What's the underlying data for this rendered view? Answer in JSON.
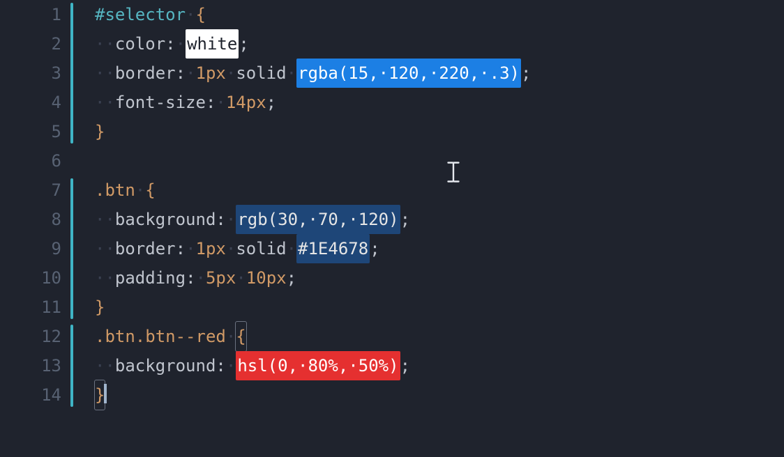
{
  "editor": {
    "line_count": 14,
    "fold_regions": [
      {
        "start": 1,
        "end": 5
      },
      {
        "start": 7,
        "end": 11
      },
      {
        "start": 12,
        "end": 14
      }
    ],
    "cursor_line": 14,
    "lines": {
      "l1": {
        "selector_id": "#selector",
        "brace_open": "{"
      },
      "l2": {
        "prop": "color",
        "value_white": "white"
      },
      "l3": {
        "prop": "border",
        "len_num": "1",
        "len_unit": "px",
        "style": "solid",
        "fn": "rgba",
        "a1": "15",
        "a2": "120",
        "a3": "220",
        "a4": ".3"
      },
      "l4": {
        "prop": "font-size",
        "num": "14",
        "unit": "px"
      },
      "l5": {
        "brace_close": "}"
      },
      "l7": {
        "selector_cls": ".btn",
        "brace_open": "{"
      },
      "l8": {
        "prop": "background",
        "fn": "rgb",
        "a1": "30",
        "a2": "70",
        "a3": "120"
      },
      "l9": {
        "prop": "border",
        "len_num": "1",
        "len_unit": "px",
        "style": "solid",
        "hex": "1E4678"
      },
      "l10": {
        "prop": "padding",
        "n1": "5",
        "u1": "px",
        "n2": "10",
        "u2": "px"
      },
      "l11": {
        "brace_close": "}"
      },
      "l12": {
        "selector_cls_a": ".btn",
        "selector_cls_b": ".btn--red",
        "brace_open": "{"
      },
      "l13": {
        "prop": "background",
        "fn": "hsl",
        "a1": "0",
        "a2": "80",
        "a2u": "%",
        "a3": "50",
        "a3u": "%"
      },
      "l14": {
        "brace_close": "}"
      }
    },
    "glyphs": {
      "ws_dot": "·",
      "comma": ",",
      "colon": ":",
      "semi": ";",
      "paren_open": "(",
      "paren_close": ")",
      "hash": "#"
    }
  }
}
